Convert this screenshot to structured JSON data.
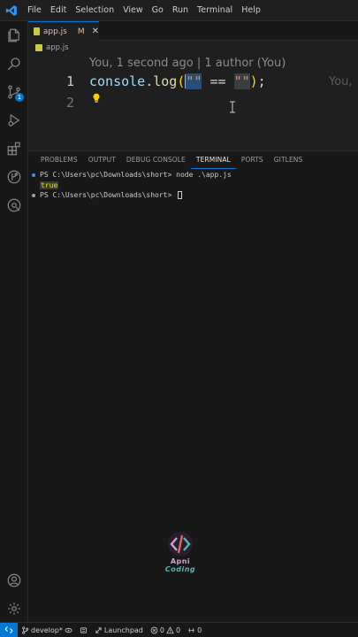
{
  "menu": {
    "items": [
      "File",
      "Edit",
      "Selection",
      "View",
      "Go",
      "Run",
      "Terminal",
      "Help"
    ]
  },
  "activity": {
    "source_control_badge": "1"
  },
  "tab": {
    "label": "app.js",
    "modified": "M",
    "close": "✕"
  },
  "breadcrumb": {
    "file": "app.js"
  },
  "editor": {
    "codelens": "You, 1 second ago | 1 author (You)",
    "line_numbers": [
      "1",
      "2"
    ],
    "tokens": {
      "object": "console",
      "dot": ".",
      "method": "log",
      "open_paren": "(",
      "string_left": "\"\"",
      "operator": " == ",
      "string_right": "\"\"",
      "close_paren": ")",
      "semicolon": ";"
    },
    "inline_blame": "You,"
  },
  "panel": {
    "tabs": [
      "PROBLEMS",
      "OUTPUT",
      "DEBUG CONSOLE",
      "TERMINAL",
      "PORTS",
      "GITLENS"
    ],
    "active_tab": "TERMINAL"
  },
  "terminal": {
    "line1": "PS C:\\Users\\pc\\Downloads\\short> node .\\app.js",
    "output": "true",
    "line2": "PS C:\\Users\\pc\\Downloads\\short> "
  },
  "watermark": {
    "line1": "Apni",
    "line2": "Coding"
  },
  "statusbar": {
    "branch": "develop*",
    "launchpad": "Launchpad",
    "errors": "0",
    "warnings": "0",
    "ports": "0"
  },
  "colors": {
    "accent": "#0078d4",
    "editor_bg": "#1f1f1f",
    "panel_bg": "#181818",
    "keyword_object": "#9cdcfe",
    "function": "#dcdcaa",
    "string": "#ce9178",
    "bracket": "#ffd700",
    "terminal_output": "#e5e510"
  },
  "icons": [
    "vscode-logo-icon",
    "explorer-icon",
    "search-icon",
    "source-control-icon",
    "run-debug-icon",
    "extensions-icon",
    "gitlens-icon",
    "remote-explorer-icon",
    "account-icon",
    "settings-gear-icon",
    "lightbulb-icon",
    "remote-icon",
    "branch-icon",
    "sync-icon",
    "launchpad-icon",
    "error-icon",
    "warning-icon",
    "ports-icon"
  ]
}
